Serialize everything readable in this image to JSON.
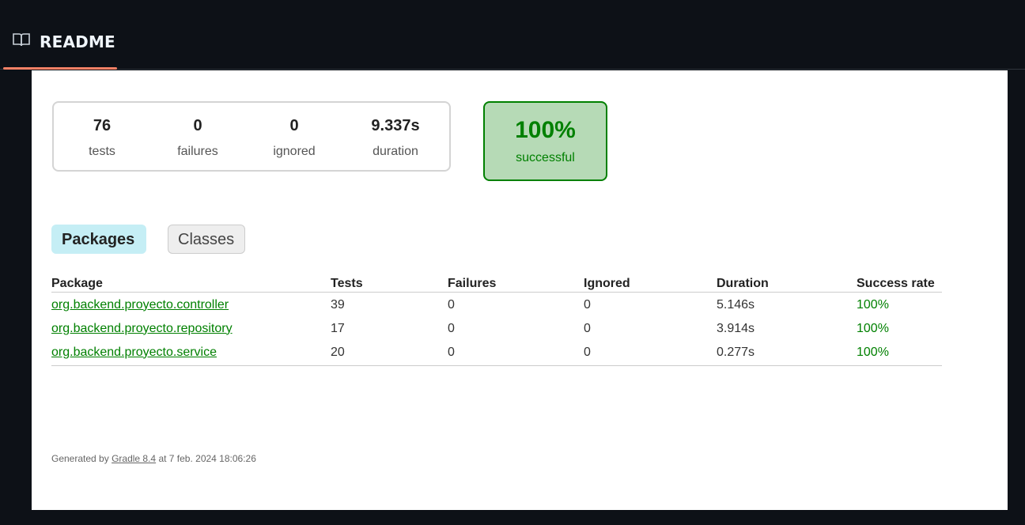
{
  "header": {
    "tab_label": "README",
    "tab_icon": "book-icon",
    "accent_color": "#f78166"
  },
  "summary": {
    "counters": [
      {
        "value": "76",
        "caption": "tests"
      },
      {
        "value": "0",
        "caption": "failures"
      },
      {
        "value": "0",
        "caption": "ignored"
      },
      {
        "value": "9.337s",
        "caption": "duration"
      }
    ],
    "success": {
      "value": "100%",
      "caption": "successful",
      "color": "#008000"
    }
  },
  "tabs": {
    "packages": "Packages",
    "classes": "Classes"
  },
  "table": {
    "headers": [
      "Package",
      "Tests",
      "Failures",
      "Ignored",
      "Duration",
      "Success rate"
    ],
    "rows": [
      {
        "package": "org.backend.proyecto.controller",
        "tests": "39",
        "failures": "0",
        "ignored": "0",
        "duration": "5.146s",
        "rate": "100%"
      },
      {
        "package": "org.backend.proyecto.repository",
        "tests": "17",
        "failures": "0",
        "ignored": "0",
        "duration": "3.914s",
        "rate": "100%"
      },
      {
        "package": "org.backend.proyecto.service",
        "tests": "20",
        "failures": "0",
        "ignored": "0",
        "duration": "0.277s",
        "rate": "100%"
      }
    ]
  },
  "footer": {
    "prefix": "Generated by ",
    "link": "Gradle 8.4",
    "suffix": " at 7 feb. 2024 18:06:26"
  }
}
